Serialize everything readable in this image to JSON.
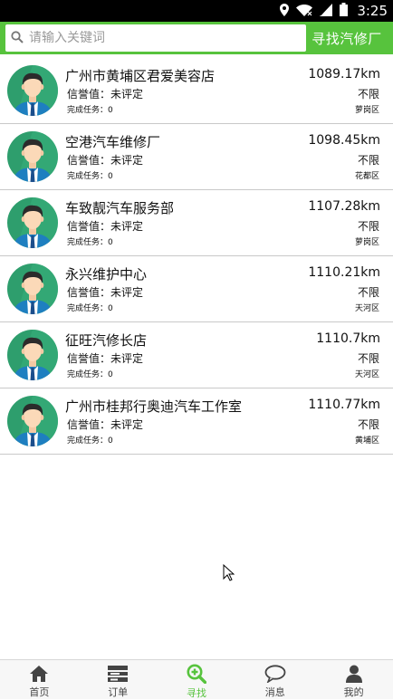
{
  "status_bar": {
    "time": "3:25"
  },
  "search": {
    "placeholder": "请输入关键词",
    "button_label": "寻找汽修厂"
  },
  "colors": {
    "brand_green": "#57c33d",
    "status_bar": "#000000",
    "avatar_bg": "#2e9e6d"
  },
  "shops": [
    {
      "name": "广州市黄埔区君爱美容店",
      "credit": "信誉值：未评定",
      "tasks": "完成任务：0",
      "distance": "1089.17km",
      "limit": "不限",
      "area": "萝岗区"
    },
    {
      "name": "空港汽车维修厂",
      "credit": "信誉值：未评定",
      "tasks": "完成任务：0",
      "distance": "1098.45km",
      "limit": "不限",
      "area": "花都区"
    },
    {
      "name": "车致靓汽车服务部",
      "credit": "信誉值：未评定",
      "tasks": "完成任务：0",
      "distance": "1107.28km",
      "limit": "不限",
      "area": "萝岗区"
    },
    {
      "name": "永兴维护中心",
      "credit": "信誉值：未评定",
      "tasks": "完成任务：0",
      "distance": "1110.21km",
      "limit": "不限",
      "area": "天河区"
    },
    {
      "name": "征旺汽修长店",
      "credit": "信誉值：未评定",
      "tasks": "完成任务：0",
      "distance": "1110.7km",
      "limit": "不限",
      "area": "天河区"
    },
    {
      "name": "广州市桂邦行奥迪汽车工作室",
      "credit": "信誉值：未评定",
      "tasks": "完成任务：0",
      "distance": "1110.77km",
      "limit": "不限",
      "area": "黄埔区"
    }
  ],
  "tabs": [
    {
      "label": "首页",
      "icon": "home-icon"
    },
    {
      "label": "订单",
      "icon": "orders-icon"
    },
    {
      "label": "寻找",
      "icon": "search-plus-icon",
      "active": true
    },
    {
      "label": "消息",
      "icon": "message-icon"
    },
    {
      "label": "我的",
      "icon": "user-icon"
    }
  ]
}
